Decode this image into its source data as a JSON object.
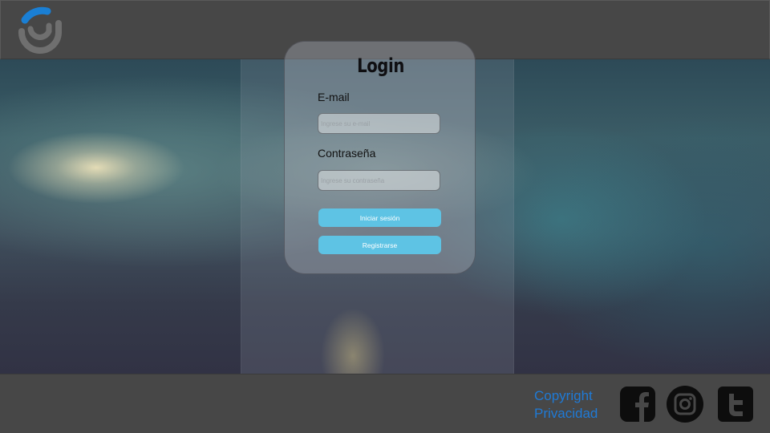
{
  "header": {
    "logo_icon": "circular-arc-logo",
    "logo_colors": {
      "primary": "#1a7fd4",
      "secondary": "#6f6f6f"
    }
  },
  "login": {
    "title": "Login",
    "email_label": "E-mail",
    "email_placeholder": "Ingrese su e-mail",
    "password_label": "Contraseña",
    "password_placeholder": "Ingrese su contraseña",
    "login_button": "Iniciar sesión",
    "register_button": "Registrarse",
    "button_color": "#5ec3e4"
  },
  "footer": {
    "links": [
      "Copyright",
      "Privacidad"
    ],
    "link_color": "#1f7ad6",
    "social": [
      "facebook-icon",
      "instagram-icon",
      "twitter-icon"
    ]
  }
}
